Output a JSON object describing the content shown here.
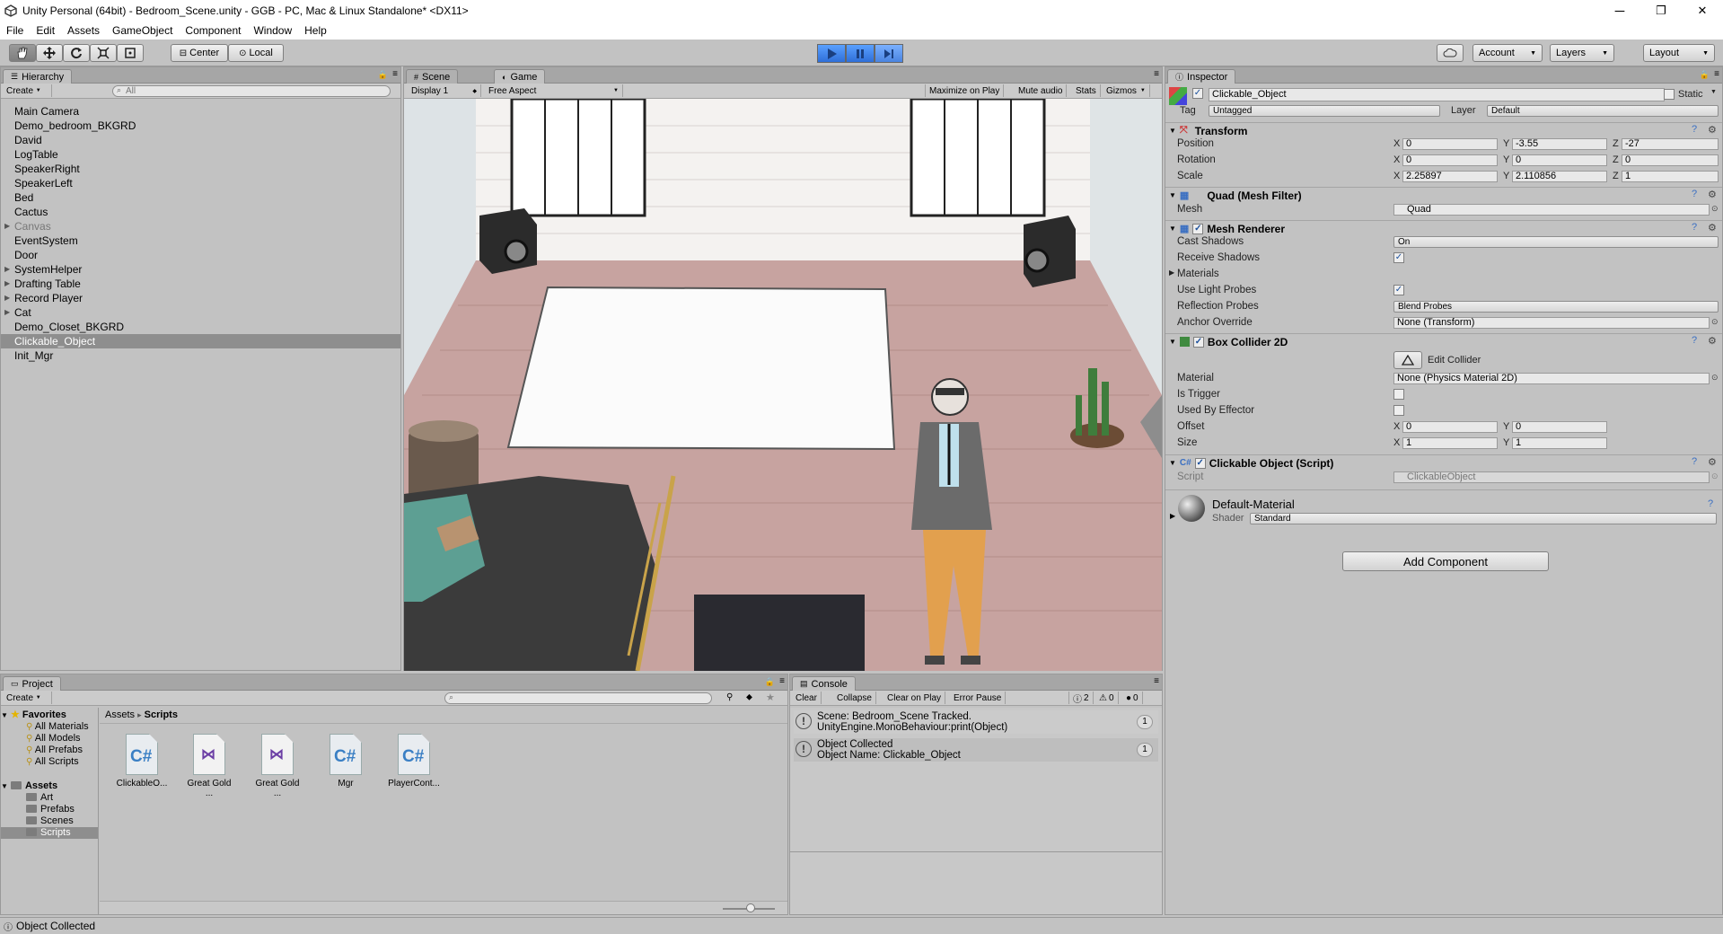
{
  "window": {
    "title": "Unity Personal (64bit) - Bedroom_Scene.unity - GGB - PC, Mac & Linux Standalone* <DX11>",
    "minimize": "─",
    "restore": "❐",
    "close": "✕"
  },
  "menu": [
    "File",
    "Edit",
    "Assets",
    "GameObject",
    "Component",
    "Window",
    "Help"
  ],
  "toolbar": {
    "center_label": "Center",
    "local_label": "Local",
    "account_label": "Account",
    "layers_label": "Layers",
    "layout_label": "Layout"
  },
  "hierarchy": {
    "tab_label": "Hierarchy",
    "create_label": "Create",
    "search_placeholder": "All",
    "items": [
      {
        "label": "Main Camera",
        "arrow": ""
      },
      {
        "label": "Demo_bedroom_BKGRD",
        "arrow": ""
      },
      {
        "label": "David",
        "arrow": ""
      },
      {
        "label": "LogTable",
        "arrow": ""
      },
      {
        "label": "SpeakerRight",
        "arrow": ""
      },
      {
        "label": "SpeakerLeft",
        "arrow": ""
      },
      {
        "label": "Bed",
        "arrow": ""
      },
      {
        "label": "Cactus",
        "arrow": ""
      },
      {
        "label": "Canvas",
        "arrow": "▶"
      },
      {
        "label": "EventSystem",
        "arrow": ""
      },
      {
        "label": "Door",
        "arrow": ""
      },
      {
        "label": "SystemHelper",
        "arrow": "▶"
      },
      {
        "label": "Drafting Table",
        "arrow": "▶"
      },
      {
        "label": "Record Player",
        "arrow": "▶"
      },
      {
        "label": "Cat",
        "arrow": "▶"
      },
      {
        "label": "Demo_Closet_BKGRD",
        "arrow": ""
      },
      {
        "label": "Clickable_Object",
        "arrow": ""
      },
      {
        "label": "Init_Mgr",
        "arrow": ""
      }
    ]
  },
  "scene_view": {
    "tab_scene": "Scene",
    "tab_game": "Game",
    "display": "Display 1",
    "aspect": "Free Aspect",
    "maximize": "Maximize on Play",
    "mute": "Mute audio",
    "stats": "Stats",
    "gizmos": "Gizmos"
  },
  "inspector": {
    "tab_label": "Inspector",
    "object_name": "Clickable_Object",
    "static_label": "Static",
    "tag_label": "Tag",
    "tag_value": "Untagged",
    "layer_label": "Layer",
    "layer_value": "Default",
    "transform": {
      "title": "Transform",
      "position_label": "Position",
      "rotation_label": "Rotation",
      "scale_label": "Scale",
      "position": {
        "x": "0",
        "y": "-3.55",
        "z": "-27"
      },
      "rotation": {
        "x": "0",
        "y": "0",
        "z": "0"
      },
      "scale": {
        "x": "2.25897",
        "y": "2.110856",
        "z": "1"
      }
    },
    "mesh_filter": {
      "title": "Quad (Mesh Filter)",
      "mesh_label": "Mesh",
      "mesh_value": "Quad"
    },
    "mesh_renderer": {
      "title": "Mesh Renderer",
      "cast_shadows_label": "Cast Shadows",
      "cast_shadows_value": "On",
      "receive_shadows_label": "Receive Shadows",
      "materials_label": "Materials",
      "light_probes_label": "Use Light Probes",
      "reflection_label": "Reflection Probes",
      "reflection_value": "Blend Probes",
      "anchor_label": "Anchor Override",
      "anchor_value": "None (Transform)"
    },
    "box_collider": {
      "title": "Box Collider 2D",
      "edit_label": "Edit Collider",
      "material_label": "Material",
      "material_value": "None (Physics Material 2D)",
      "trigger_label": "Is Trigger",
      "effector_label": "Used By Effector",
      "offset_label": "Offset",
      "offset": {
        "x": "0",
        "y": "0"
      },
      "size_label": "Size",
      "size": {
        "x": "1",
        "y": "1"
      }
    },
    "script": {
      "title": "Clickable Object (Script)",
      "script_label": "Script",
      "script_value": "ClickableObject"
    },
    "material": {
      "name": "Default-Material",
      "shader_label": "Shader",
      "shader_value": "Standard"
    },
    "add_component": "Add Component"
  },
  "project": {
    "tab_label": "Project",
    "create_label": "Create",
    "favorites_label": "Favorites",
    "favorites": [
      "All Materials",
      "All Models",
      "All Prefabs",
      "All Scripts"
    ],
    "assets_label": "Assets",
    "folders": [
      "Art",
      "Prefabs",
      "Scenes",
      "Scripts"
    ],
    "breadcrumb_root": "Assets",
    "breadcrumb_sep": "▸",
    "breadcrumb_current": "Scripts",
    "assets": [
      {
        "label": "ClickableO...",
        "kind": "cs"
      },
      {
        "label": "Great Gold ...",
        "kind": "vs"
      },
      {
        "label": "Great Gold ...",
        "kind": "vs"
      },
      {
        "label": "Mgr",
        "kind": "cs"
      },
      {
        "label": "PlayerCont...",
        "kind": "cs"
      }
    ]
  },
  "console": {
    "tab_label": "Console",
    "clear": "Clear",
    "collapse": "Collapse",
    "clear_on_play": "Clear on Play",
    "error_pause": "Error Pause",
    "count_info": "2",
    "count_warn": "0",
    "count_err": "0",
    "entries": [
      {
        "text": "Scene: Bedroom_Scene Tracked.\nUnityEngine.MonoBehaviour:print(Object)",
        "count": "1"
      },
      {
        "text": "Object Collected\nObject Name: Clickable_Object",
        "count": "1"
      }
    ]
  },
  "status_bar": "Object Collected",
  "colors": {
    "accent": "#3b7de0",
    "selection": "#8e8e8e",
    "panel": "#c2c2c2"
  }
}
